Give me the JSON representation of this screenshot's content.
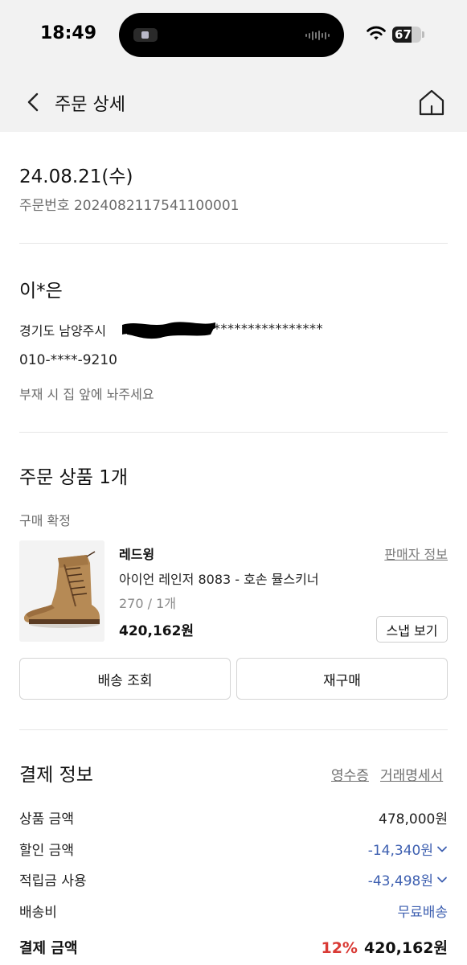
{
  "status_bar": {
    "time": "18:49",
    "battery_level": 67,
    "battery_text": "67"
  },
  "header": {
    "title": "주문 상세",
    "back_icon": "chevron-left-icon",
    "home_icon": "home-icon"
  },
  "order": {
    "date": "24.08.21(수)",
    "number_text": "주문번호 2024082117541100001"
  },
  "shipping": {
    "recipient": "이*은",
    "address_prefix": "경기도 남양주시",
    "address_masked": "****************",
    "phone": "010-****-9210",
    "memo": "부재 시 집 앞에 놔주세요"
  },
  "items": {
    "title": "주문 상품 1개",
    "status": "구매 확정",
    "product": {
      "brand": "레드윙",
      "seller_link": "판매자 정보",
      "name": "아이언 레인저 8083 - 호손 뮬스키너",
      "option": "270 / 1개",
      "price": "420,162원",
      "snap_button": "스냅 보기"
    },
    "track_button": "배송 조회",
    "reorder_button": "재구매"
  },
  "payment": {
    "title": "결제 정보",
    "receipt_link": "영수증",
    "statement_link": "거래명세서",
    "rows": [
      {
        "label": "상품 금액",
        "value": "478,000원"
      },
      {
        "label": "할인 금액",
        "value": "-14,340원"
      },
      {
        "label": "적립금 사용",
        "value": "-43,498원"
      },
      {
        "label": "배송비",
        "value": "무료배송"
      }
    ],
    "total_label": "결제 금액",
    "total_percent": "12%",
    "total_amount": "420,162원"
  },
  "colors": {
    "accent_blue": "#3d5fb0",
    "discount_red": "#d93a35",
    "header_bg": "#f2f2f2"
  }
}
